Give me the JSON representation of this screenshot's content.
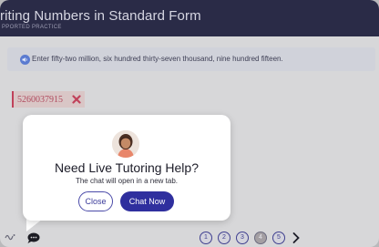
{
  "header": {
    "title": "riting Numbers in Standard Form",
    "subtitle": "PPORTED PRACTICE"
  },
  "instruction": {
    "icon": "speaker-icon",
    "text": "Enter fifty-two million, six hundred thirty-seven thousand, nine hundred fifteen."
  },
  "answer": {
    "value": "5260037915",
    "status": "incorrect",
    "status_icon": "x-mark-icon",
    "colors": {
      "status": "#c0415a"
    }
  },
  "modal": {
    "title": "Need Live Tutoring Help?",
    "subtitle": "The chat will open in a new tab.",
    "close_label": "Close",
    "chat_label": "Chat Now",
    "colors": {
      "primary": "#2f2f9e"
    }
  },
  "pager": {
    "pages": [
      "1",
      "2",
      "3",
      "4",
      "5"
    ],
    "current": "4",
    "next_icon": "chevron-right-icon"
  },
  "bottom": {
    "chat_icon": "chat-bubble-icon",
    "left_icon": "wave-icon"
  }
}
